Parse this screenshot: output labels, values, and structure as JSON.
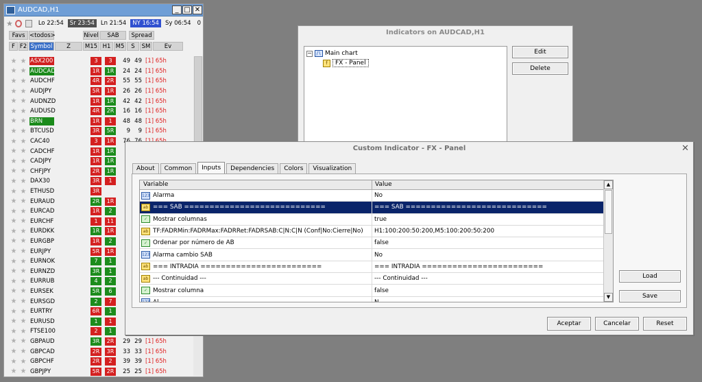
{
  "panel": {
    "title": "AUDCAD,H1",
    "sessions": [
      {
        "label": "Lo 22:54",
        "style": "plain"
      },
      {
        "label": "Sr 23:54",
        "style": "dark"
      },
      {
        "label": "Ln 21:54",
        "style": "plain"
      },
      {
        "label": "NY 16:54",
        "style": "blue"
      },
      {
        "label": "Sy 06:54",
        "style": "plain"
      },
      {
        "label": "0",
        "style": "plain"
      }
    ],
    "header1": {
      "favs": "Favs",
      "todos": "<todos>",
      "nivel": "Nivel",
      "sab": "SAB",
      "spread": "Spread"
    },
    "header2": {
      "f": "F",
      "f2": "F2",
      "symbol": "Symbol",
      "z": "Z",
      "m15": "M15",
      "h1": "H1",
      "m5": "M5",
      "s": "S",
      "sm": "SM",
      "ev": "Ev"
    },
    "rows": [
      {
        "sym": "ASX200",
        "symStyle": "red",
        "h1": "3",
        "h1c": "red",
        "m5": "3",
        "m5c": "red",
        "s": "49",
        "sm": "49",
        "ev": "[1] 65h"
      },
      {
        "sym": "AUDCAD",
        "symStyle": "green",
        "h1": "1R",
        "h1c": "red",
        "m5": "1R",
        "m5c": "green",
        "s": "24",
        "sm": "24",
        "ev": "[1] 65h"
      },
      {
        "sym": "AUDCHF",
        "symStyle": "",
        "h1": "4R",
        "h1c": "red",
        "m5": "2R",
        "m5c": "red",
        "s": "55",
        "sm": "55",
        "ev": "[1] 65h"
      },
      {
        "sym": "AUDJPY",
        "symStyle": "",
        "h1": "5R",
        "h1c": "red",
        "m5": "1R",
        "m5c": "red",
        "s": "26",
        "sm": "26",
        "ev": "[1] 65h"
      },
      {
        "sym": "AUDNZD",
        "symStyle": "",
        "h1": "1R",
        "h1c": "red",
        "m5": "1R",
        "m5c": "green",
        "s": "42",
        "sm": "42",
        "ev": "[1] 65h"
      },
      {
        "sym": "AUDUSD",
        "symStyle": "",
        "h1": "4R",
        "h1c": "red",
        "m5": "2R",
        "m5c": "green",
        "s": "16",
        "sm": "16",
        "ev": "[1] 65h"
      },
      {
        "sym": "BRN",
        "symStyle": "green",
        "h1": "1R",
        "h1c": "red",
        "m5": "1",
        "m5c": "red",
        "s": "48",
        "sm": "48",
        "ev": "[1] 65h"
      },
      {
        "sym": "BTCUSD",
        "symStyle": "",
        "h1": "3R",
        "h1c": "red",
        "m5": "5R",
        "m5c": "green",
        "s": "9",
        "sm": "9",
        "ev": "[1] 65h"
      },
      {
        "sym": "CAC40",
        "symStyle": "",
        "h1": "3",
        "h1c": "red",
        "m5": "1R",
        "m5c": "red",
        "s": "76",
        "sm": "76",
        "ev": "[1] 65h"
      },
      {
        "sym": "CADCHF",
        "symStyle": "",
        "h1": "1R",
        "h1c": "red",
        "m5": "1R",
        "m5c": "green",
        "s": "",
        "sm": "",
        "ev": ""
      },
      {
        "sym": "CADJPY",
        "symStyle": "",
        "h1": "1R",
        "h1c": "red",
        "m5": "1R",
        "m5c": "green",
        "s": "",
        "sm": "",
        "ev": ""
      },
      {
        "sym": "CHFJPY",
        "symStyle": "",
        "h1": "2R",
        "h1c": "red",
        "m5": "1R",
        "m5c": "green",
        "s": "",
        "sm": "",
        "ev": ""
      },
      {
        "sym": "DAX30",
        "symStyle": "",
        "h1": "3R",
        "h1c": "red",
        "m5": "1",
        "m5c": "red",
        "s": "",
        "sm": "",
        "ev": ""
      },
      {
        "sym": "ETHUSD",
        "symStyle": "",
        "h1": "3R",
        "h1c": "red",
        "m5": "",
        "m5c": "none",
        "s": "",
        "sm": "",
        "ev": ""
      },
      {
        "sym": "EURAUD",
        "symStyle": "",
        "h1": "2R",
        "h1c": "green",
        "m5": "1R",
        "m5c": "red",
        "s": "",
        "sm": "",
        "ev": ""
      },
      {
        "sym": "EURCAD",
        "symStyle": "",
        "h1": "1R",
        "h1c": "red",
        "m5": "2",
        "m5c": "green",
        "s": "",
        "sm": "",
        "ev": ""
      },
      {
        "sym": "EURCHF",
        "symStyle": "",
        "h1": "1",
        "h1c": "red",
        "m5": "11",
        "m5c": "red",
        "s": "",
        "sm": "",
        "ev": ""
      },
      {
        "sym": "EURDKK",
        "symStyle": "",
        "h1": "1R",
        "h1c": "green",
        "m5": "1R",
        "m5c": "red",
        "s": "",
        "sm": "",
        "ev": ""
      },
      {
        "sym": "EURGBP",
        "symStyle": "",
        "h1": "1R",
        "h1c": "red",
        "m5": "2",
        "m5c": "green",
        "s": "",
        "sm": "",
        "ev": ""
      },
      {
        "sym": "EURJPY",
        "symStyle": "",
        "h1": "5R",
        "h1c": "red",
        "m5": "1R",
        "m5c": "red",
        "s": "",
        "sm": "",
        "ev": ""
      },
      {
        "sym": "EURNOK",
        "symStyle": "",
        "h1": "7",
        "h1c": "green",
        "m5": "1",
        "m5c": "green",
        "s": "",
        "sm": "",
        "ev": ""
      },
      {
        "sym": "EURNZD",
        "symStyle": "",
        "h1": "3R",
        "h1c": "green",
        "m5": "1",
        "m5c": "green",
        "s": "",
        "sm": "",
        "ev": ""
      },
      {
        "sym": "EURRUB",
        "symStyle": "",
        "h1": "4",
        "h1c": "green",
        "m5": "2",
        "m5c": "green",
        "s": "",
        "sm": "",
        "ev": ""
      },
      {
        "sym": "EURSEK",
        "symStyle": "",
        "h1": "5R",
        "h1c": "green",
        "m5": "6",
        "m5c": "green",
        "s": "",
        "sm": "",
        "ev": ""
      },
      {
        "sym": "EURSGD",
        "symStyle": "",
        "h1": "2",
        "h1c": "green",
        "m5": "7",
        "m5c": "red",
        "s": "",
        "sm": "",
        "ev": ""
      },
      {
        "sym": "EURTRY",
        "symStyle": "",
        "h1": "6R",
        "h1c": "red",
        "m5": "1",
        "m5c": "green",
        "s": "",
        "sm": "",
        "ev": ""
      },
      {
        "sym": "EURUSD",
        "symStyle": "",
        "h1": "1",
        "h1c": "green",
        "m5": "1",
        "m5c": "red",
        "s": "",
        "sm": "",
        "ev": ""
      },
      {
        "sym": "FTSE100",
        "symStyle": "",
        "h1": "2",
        "h1c": "red",
        "m5": "1",
        "m5c": "green",
        "s": "",
        "sm": "",
        "ev": ""
      },
      {
        "sym": "GBPAUD",
        "symStyle": "",
        "h1": "3R",
        "h1c": "green",
        "m5": "2R",
        "m5c": "red",
        "s": "29",
        "sm": "29",
        "ev": "[1] 65h"
      },
      {
        "sym": "GBPCAD",
        "symStyle": "",
        "h1": "2R",
        "h1c": "red",
        "m5": "3R",
        "m5c": "red",
        "s": "33",
        "sm": "33",
        "ev": "[1] 65h"
      },
      {
        "sym": "GBPCHF",
        "symStyle": "",
        "h1": "2R",
        "h1c": "red",
        "m5": "2",
        "m5c": "red",
        "s": "39",
        "sm": "39",
        "ev": "[1] 65h"
      },
      {
        "sym": "GBPJPY",
        "symStyle": "",
        "h1": "5R",
        "h1c": "red",
        "m5": "2R",
        "m5c": "red",
        "s": "25",
        "sm": "25",
        "ev": "[1] 65h"
      }
    ]
  },
  "indicators": {
    "title": "Indicators on AUDCAD,H1",
    "tree": {
      "root": "Main chart",
      "child": "FX - Panel"
    },
    "edit": "Edit",
    "delete": "Delete"
  },
  "dialog": {
    "title": "Custom Indicator - FX - Panel",
    "tabs": [
      "About",
      "Common",
      "Inputs",
      "Dependencies",
      "Colors",
      "Visualization"
    ],
    "activeTab": 2,
    "columns": {
      "variable": "Variable",
      "value": "Value"
    },
    "params": [
      {
        "type": "num",
        "name": "Alarma",
        "value": "No"
      },
      {
        "type": "str",
        "name": "=== SAB ============================",
        "value": "=== SAB ============================",
        "selected": true
      },
      {
        "type": "bool",
        "name": "Mostrar columnas",
        "value": "true"
      },
      {
        "type": "str",
        "name": "TF:FADRMin:FADRMax:FADRRet:FADRSAB:C|N:C|N (Conf|No:Cierre|No)",
        "value": "H1:100:200:50:200,M5:100:200:50:200"
      },
      {
        "type": "bool",
        "name": "Ordenar por número de AB",
        "value": "false"
      },
      {
        "type": "num",
        "name": "Alarma cambio SAB",
        "value": "No"
      },
      {
        "type": "str",
        "name": "=== INTRADIA ========================",
        "value": "=== INTRADIA ========================"
      },
      {
        "type": "str",
        "name": "--- Continuidad ---",
        "value": "--- Continuidad ---"
      },
      {
        "type": "bool",
        "name": "Mostrar columna",
        "value": "false"
      },
      {
        "type": "num",
        "name": "Al...",
        "value": "N..."
      }
    ],
    "load": "Load",
    "save": "Save",
    "ok": "Aceptar",
    "cancel": "Cancelar",
    "reset": "Reset"
  }
}
